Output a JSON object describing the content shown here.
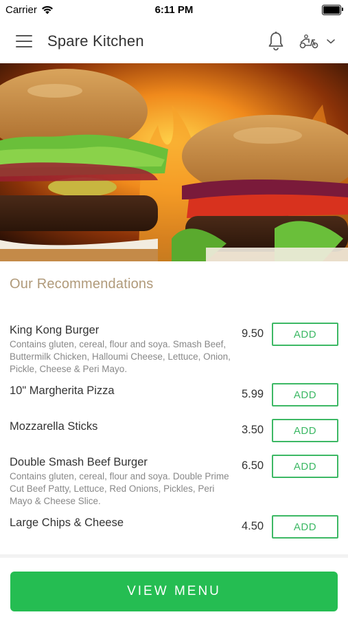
{
  "status_bar": {
    "carrier": "Carrier",
    "time": "6:11 PM"
  },
  "header": {
    "title": "Spare Kitchen",
    "icons": [
      "menu-icon",
      "bell-icon",
      "scooter-icon",
      "chevron-down-icon"
    ]
  },
  "recommendations": {
    "title": "Our Recommendations",
    "add_label": "ADD",
    "items": [
      {
        "name": "King Kong Burger",
        "description": "Contains gluten, cereal, flour and soya. Smash Beef, Buttermilk Chicken, Halloumi Cheese, Lettuce, Onion, Pickle, Cheese & Peri Mayo.",
        "price": "9.50"
      },
      {
        "name": "10\" Margherita Pizza",
        "description": "",
        "price": "5.99"
      },
      {
        "name": "Mozzarella Sticks",
        "description": "",
        "price": "3.50"
      },
      {
        "name": "Double Smash Beef Burger",
        "description": "Contains gluten, cereal, flour and soya. Double Prime Cut Beef Patty, Lettuce, Red Onions, Pickles, Peri Mayo & Cheese Slice.",
        "price": "6.50"
      },
      {
        "name": "Large Chips & Cheese",
        "description": "",
        "price": "4.50"
      }
    ]
  },
  "footer": {
    "view_menu_label": "VIEW MENU"
  },
  "colors": {
    "accent_green": "#25bd52",
    "button_outline": "#3cb864",
    "section_title": "#b09a7a"
  }
}
